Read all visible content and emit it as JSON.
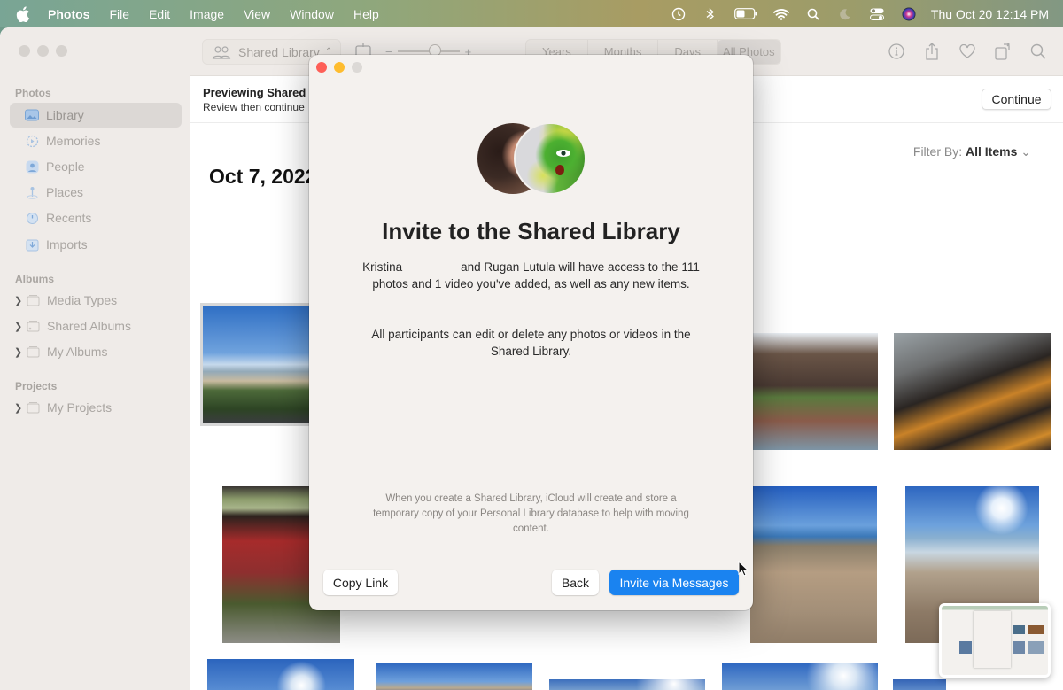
{
  "menubar": {
    "app_name": "Photos",
    "menus": [
      "File",
      "Edit",
      "Image",
      "View",
      "Window",
      "Help"
    ],
    "status_icons": [
      "time-machine-icon",
      "bluetooth-icon",
      "battery-icon",
      "wifi-icon",
      "spotlight-icon",
      "focus-moon-icon",
      "control-center-icon",
      "siri-icon"
    ],
    "clock": "Thu Oct 20  12:14 PM"
  },
  "sidebar": {
    "sections": [
      {
        "label": "Photos",
        "items": [
          {
            "label": "Library",
            "icon": "library-icon",
            "active": true
          },
          {
            "label": "Memories",
            "icon": "memories-icon"
          },
          {
            "label": "People",
            "icon": "people-icon"
          },
          {
            "label": "Places",
            "icon": "places-icon"
          },
          {
            "label": "Recents",
            "icon": "recents-icon"
          },
          {
            "label": "Imports",
            "icon": "imports-icon"
          }
        ]
      },
      {
        "label": "Albums",
        "items": [
          {
            "label": "Media Types",
            "icon": "folder-icon"
          },
          {
            "label": "Shared Albums",
            "icon": "shared-folder-icon"
          },
          {
            "label": "My Albums",
            "icon": "folder-icon"
          }
        ]
      },
      {
        "label": "Projects",
        "items": [
          {
            "label": "My Projects",
            "icon": "folder-icon"
          }
        ]
      }
    ]
  },
  "toolbar": {
    "library_picker": "Shared Library",
    "zoom_minus": "−",
    "zoom_plus": "+",
    "zoom_level": 0.6,
    "view_segments": [
      "Years",
      "Months",
      "Days",
      "All Photos"
    ],
    "active_segment": "All Photos",
    "right_icons": [
      "info-icon",
      "share-icon",
      "heart-icon",
      "rotate-icon",
      "search-icon"
    ]
  },
  "banner": {
    "title": "Previewing Shared Library",
    "subtitle": "Review then continue",
    "continue_label": "Continue"
  },
  "content": {
    "filter_label": "Filter By:",
    "filter_value": "All Items",
    "date_heading": "Oct 7, 2022"
  },
  "modal": {
    "title": "Invite to the Shared Library",
    "body_line1_name1": "Kristina",
    "body_line1_rest": "and Rugan Lutula will have access to the 111 photos and 1 video you've added, as well as any new items.",
    "body_paragraph2": "All participants can edit or delete any photos or videos in the Shared Library.",
    "note": "When you create a Shared Library, iCloud will create and store a temporary copy of your Personal Library database to help with moving content.",
    "buttons": {
      "copy_link": "Copy Link",
      "back": "Back",
      "invite": "Invite via Messages"
    },
    "accent_color": "#1a83f0"
  }
}
